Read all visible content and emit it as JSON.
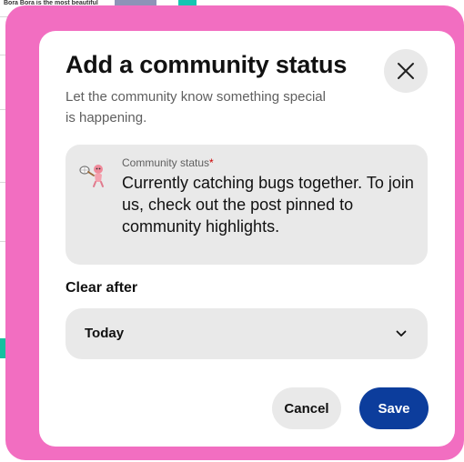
{
  "background": {
    "snippet": "Bora Bora is the most beautiful"
  },
  "modal": {
    "title": "Add a community status",
    "subtitle": "Let the community know something special is happening.",
    "close_icon": "close-icon"
  },
  "status": {
    "label": "Community status",
    "required_mark": "*",
    "text": "Currently catching bugs together. To join us, check out the post pinned to community highlights.",
    "icon": "bug-net-icon"
  },
  "clear_after": {
    "label": "Clear after",
    "selected": "Today",
    "icon": "chevron-down-icon"
  },
  "actions": {
    "cancel_label": "Cancel",
    "save_label": "Save"
  },
  "colors": {
    "frame": "#f26ec1",
    "primary": "#0c3d9c",
    "surface": "#e9e9e9",
    "required": "#cc0000"
  }
}
